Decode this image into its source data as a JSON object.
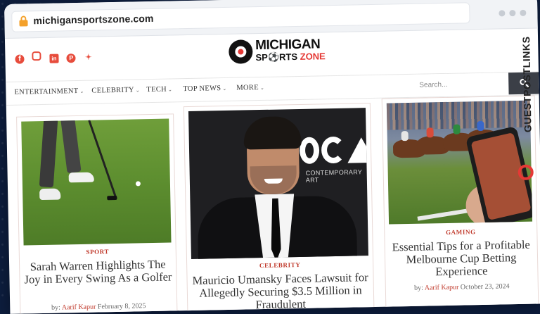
{
  "browser": {
    "url": "michigansportszone.com"
  },
  "brand": {
    "top": "MICHIGAN",
    "bottom_a": "SP",
    "bottom_b": "RTS",
    "bottom_zone": "ZONE"
  },
  "social_icons": [
    "facebook-icon",
    "instagram-icon",
    "linkedin-icon",
    "pinterest-icon",
    "twitter-icon"
  ],
  "nav": {
    "items": [
      {
        "label": "ENTERTAINMENT"
      },
      {
        "label": "CELEBRITY"
      },
      {
        "label": "TECH"
      },
      {
        "label": "TOP NEWS"
      },
      {
        "label": "MORE"
      }
    ],
    "search_placeholder": "Search..."
  },
  "articles": [
    {
      "category": "SPORT",
      "title": "Sarah Warren Highlights The Joy in Every Swing As a Golfer",
      "by": "by:",
      "author": "Aarif Kapur",
      "date": "February 8, 2025"
    },
    {
      "category": "CELEBRITY",
      "title": "Mauricio Umansky Faces Lawsuit for Allegedly Securing $3.5 Million in Fraudulent",
      "image_text": "CONTEMPORARY ART"
    },
    {
      "category": "GAMING",
      "title": "Essential Tips for a Profitable Melbourne Cup Betting Experience",
      "by": "by:",
      "author": "Aarif Kapur",
      "date": "October 23, 2024"
    }
  ],
  "side_brand": {
    "text": "GUESTPOSTLINKS"
  },
  "colors": {
    "accent": "#e53935",
    "category_red": "#c0392b",
    "search_button": "#3b3f47"
  }
}
